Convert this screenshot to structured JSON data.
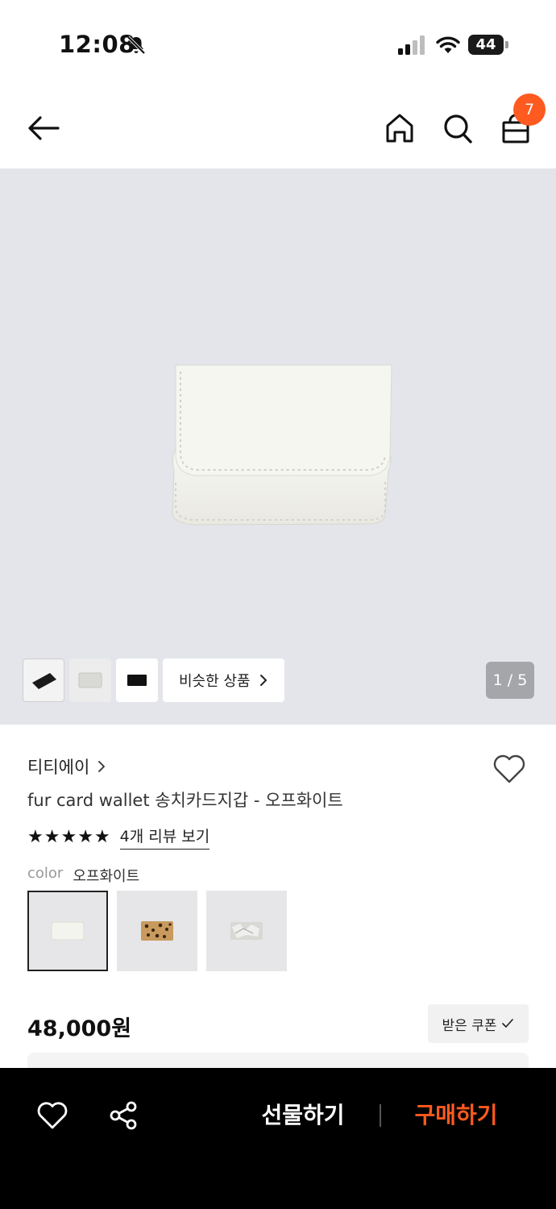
{
  "status_bar": {
    "time": "12:08",
    "battery": "44",
    "icons": [
      "bell-slash-icon",
      "cellular-signal-icon",
      "wifi-icon",
      "battery-icon"
    ]
  },
  "header": {
    "cart_count": "7",
    "icons": [
      "arrow-left-icon",
      "home-icon",
      "search-icon",
      "shopping-bag-icon"
    ]
  },
  "gallery": {
    "similar_label": "비슷한 상품",
    "page_indicator": "1 / 5",
    "current_page": 1,
    "total_pages": 5
  },
  "product": {
    "brand": "티티에이",
    "name": "fur card wallet 송치카드지갑 - 오프화이트",
    "rating": 5,
    "review_link": "4개 리뷰 보기",
    "color_label": "color",
    "color_value": "오프화이트",
    "color_options": [
      "오프화이트",
      "레오파드",
      "실버"
    ],
    "price": "48,000원",
    "coupon_label": "받은 쿠폰"
  },
  "bottom_bar": {
    "gift_label": "선물하기",
    "buy_label": "구매하기",
    "icons": [
      "heart-icon",
      "share-icon"
    ]
  },
  "colors": {
    "accent": "#ff5a1f",
    "hero_bg": "#e3e5ea",
    "bottom_bar_bg": "#000000"
  }
}
